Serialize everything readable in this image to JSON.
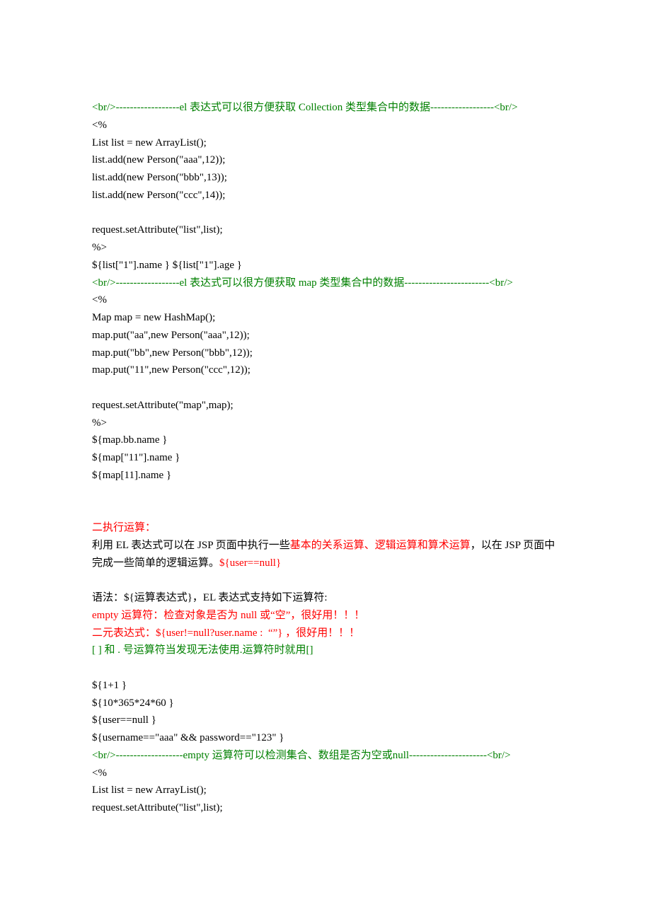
{
  "lines": [
    {
      "color": "green",
      "text": "<br/>------------------el 表达式可以很方便获取 Collection 类型集合中的数据------------------<br/>"
    },
    {
      "color": "black",
      "text": "<%"
    },
    {
      "color": "black",
      "text": "List list = new ArrayList();"
    },
    {
      "color": "black",
      "text": "list.add(new Person(\"aaa\",12));"
    },
    {
      "color": "black",
      "text": "list.add(new Person(\"bbb\",13));"
    },
    {
      "color": "black",
      "text": "list.add(new Person(\"ccc\",14));"
    },
    {
      "color": "black",
      "text": ""
    },
    {
      "color": "black",
      "text": "request.setAttribute(\"list\",list);"
    },
    {
      "color": "black",
      "text": "%>"
    },
    {
      "color": "black",
      "text": "${list[\"1\"].name } ${list[\"1\"].age }"
    },
    {
      "color": "green",
      "text": "<br/>------------------el 表达式可以很方便获取 map 类型集合中的数据------------------------<br/>"
    },
    {
      "color": "black",
      "text": "<%"
    },
    {
      "color": "black",
      "text": "Map map = new HashMap();"
    },
    {
      "color": "black",
      "text": "map.put(\"aa\",new Person(\"aaa\",12));"
    },
    {
      "color": "black",
      "text": "map.put(\"bb\",new Person(\"bbb\",12));"
    },
    {
      "color": "black",
      "text": "map.put(\"11\",new Person(\"ccc\",12));"
    },
    {
      "color": "black",
      "text": ""
    },
    {
      "color": "black",
      "text": "request.setAttribute(\"map\",map);"
    },
    {
      "color": "black",
      "text": "%>"
    },
    {
      "color": "black",
      "text": "${map.bb.name }"
    },
    {
      "color": "black",
      "text": "${map[\"11\"].name }"
    },
    {
      "color": "black",
      "text": "${map[11].name }"
    },
    {
      "color": "black",
      "text": ""
    },
    {
      "color": "black",
      "text": ""
    },
    {
      "color": "red",
      "text": "二执行运算："
    },
    {
      "spans": [
        {
          "color": "black",
          "text": "利用 EL 表达式可以在 JSP 页面中执行一些"
        },
        {
          "color": "red",
          "text": "基本的关系运算、逻辑运算和算术运算"
        },
        {
          "color": "black",
          "text": "，以在 JSP 页面中完成一些简单的逻辑运算。"
        },
        {
          "color": "red",
          "text": "${user==null}"
        }
      ]
    },
    {
      "color": "black",
      "text": ""
    },
    {
      "color": "black",
      "text": "语法：${运算表达式}，EL 表达式支持如下运算符:"
    },
    {
      "color": "red",
      "text": "empty 运算符：检查对象是否为 null 或“空”，很好用！！！"
    },
    {
      "color": "red",
      "text": "二元表达式：${user!=null?user.name :  “”} ，很好用！！！"
    },
    {
      "color": "green",
      "text": "[ ] 和 . 号运算符当发现无法使用.运算符时就用[]"
    },
    {
      "color": "black",
      "text": ""
    },
    {
      "color": "black",
      "text": "${1+1 }"
    },
    {
      "color": "black",
      "text": "${10*365*24*60 }"
    },
    {
      "color": "black",
      "text": "${user==null }"
    },
    {
      "color": "black",
      "text": "${username==\"aaa\" && password==\"123\" }"
    },
    {
      "color": "green",
      "text": "<br/>-------------------empty 运算符可以检测集合、数组是否为空或null----------------------<br/>"
    },
    {
      "color": "black",
      "text": "<%"
    },
    {
      "color": "black",
      "text": "List list = new ArrayList();"
    },
    {
      "color": "black",
      "text": "request.setAttribute(\"list\",list);"
    }
  ]
}
